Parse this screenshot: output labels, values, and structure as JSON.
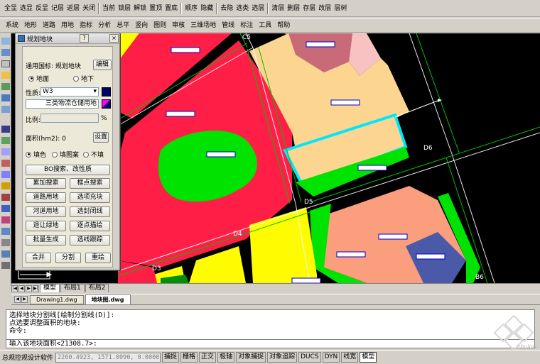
{
  "toolbar_top": [
    "全显",
    "选显",
    "反显",
    "记层",
    "返层",
    "关闭",
    "当前",
    "锁层",
    "解锁",
    "置顶",
    "置底",
    "顺序",
    "隐藏",
    "去隐",
    "选类",
    "选层",
    "清层",
    "删层",
    "存层",
    "改层",
    "层树"
  ],
  "menu": [
    "系统",
    "地形",
    "道路",
    "用地",
    "指标",
    "分析",
    "总平",
    "竖向",
    "图则",
    "审核",
    "三维场地",
    "管线",
    "标注",
    "工具",
    "帮助"
  ],
  "panel": {
    "title": "规划地块",
    "help": "?",
    "close": "×",
    "standard_label": "通用国标: 规划地块",
    "edit_btn": "编辑",
    "radio_ground": "地面",
    "radio_under": "地下",
    "nature_label": "性质:",
    "nature_value": "W3",
    "nature_desc": "三类物流仓储用地",
    "ratio_label": "比例:",
    "ratio_unit": "%",
    "area_label": "面积(hm2): 0",
    "set_btn": "设置",
    "fill_color": "填色",
    "fill_pattern": "填图案",
    "no_fill": "不填",
    "bo_btn": "BO搜索、改性质",
    "buttons": [
      [
        "累加搜索",
        "框点搜索"
      ],
      [
        "道路用地",
        "选项充块"
      ],
      [
        "河道用地",
        "选封闭线"
      ],
      [
        "退让绿地",
        "逐点描绘"
      ],
      [
        "批量生成",
        "选线跟踪"
      ]
    ],
    "bottom": [
      "合并",
      "分割",
      "重绘"
    ],
    "colors": {
      "nature_swatch": "#00006a",
      "nature_stripe": "#ff00ff"
    }
  },
  "map_labels": {
    "c5": "C5",
    "d6": "D6",
    "d5": "D5",
    "d4": "D4",
    "d3": "D3",
    "b6": "B6"
  },
  "layout_tabs": [
    "模型",
    "布局1",
    "布局2"
  ],
  "doc_tabs": [
    "Drawing1.dwg",
    "地块图.dwg"
  ],
  "command": {
    "lines": [
      "选择地块分割线[绘制分割线(D)]:",
      "点选要调整面积的地块:",
      "命令:"
    ],
    "input": "输入该地块面积<21308.7>:"
  },
  "status": {
    "app": "总规控规设计软件",
    "coords": "2260.4923, 1571.0090, 0.0000",
    "toggles": [
      "捕捉",
      "栅格",
      "正交",
      "极轴",
      "对象捕捉",
      "对象追踪",
      "DUCS",
      "DYN",
      "线宽",
      "模型"
    ]
  },
  "watermark": "zhulong.com",
  "colors": {
    "land_red": "#ff1e46",
    "land_yellow": "#fffb00",
    "land_beige": "#fcd690",
    "land_salmon": "#fa9e7e",
    "land_green": "#00e200",
    "land_pink": "#f8c2c2",
    "land_mauve": "#c86a78",
    "land_blue": "#4a5aa8",
    "selection": "#00e6ff"
  }
}
